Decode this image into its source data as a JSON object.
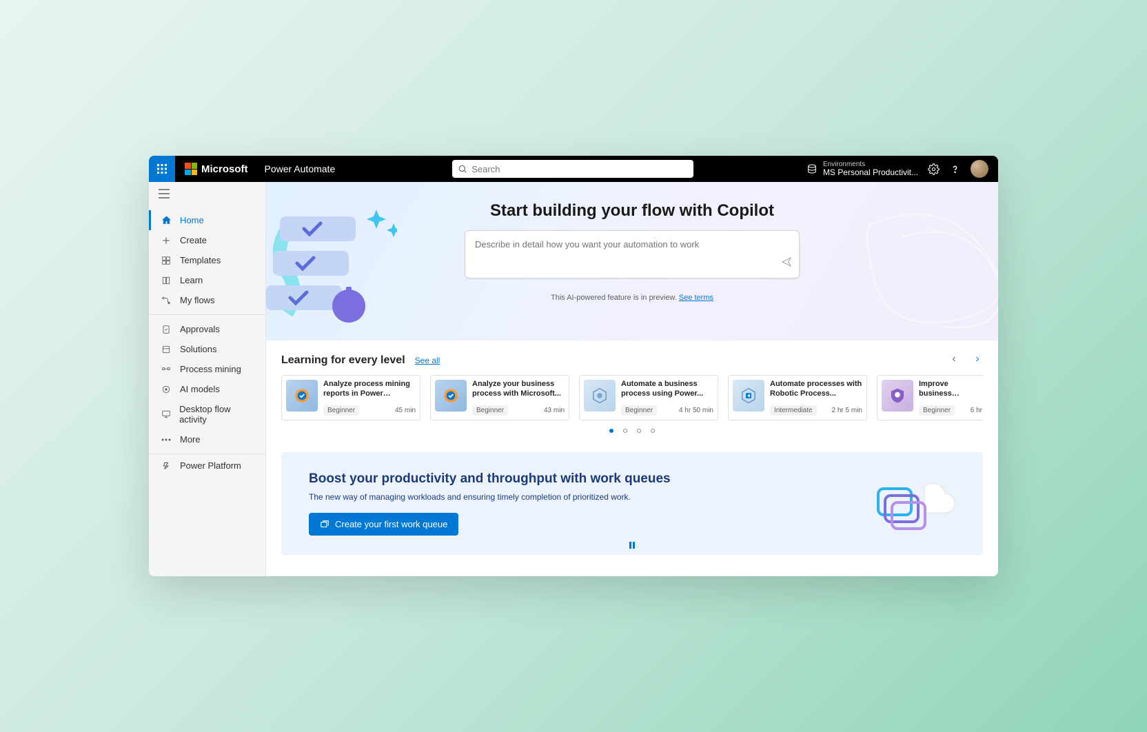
{
  "topbar": {
    "company": "Microsoft",
    "product": "Power Automate",
    "search_placeholder": "Search",
    "env_label": "Environments",
    "env_name": "MS Personal Productivit..."
  },
  "sidebar": {
    "items": [
      {
        "label": "Home"
      },
      {
        "label": "Create"
      },
      {
        "label": "Templates"
      },
      {
        "label": "Learn"
      },
      {
        "label": "My flows"
      }
    ],
    "items2": [
      {
        "label": "Approvals"
      },
      {
        "label": "Solutions"
      },
      {
        "label": "Process mining"
      },
      {
        "label": "AI models"
      },
      {
        "label": "Desktop flow activity"
      },
      {
        "label": "More"
      }
    ],
    "platform_label": "Power Platform"
  },
  "hero": {
    "title": "Start building your flow with Copilot",
    "placeholder": "Describe in detail how you want your automation to work",
    "preview_text": "This AI-powered feature is in preview. ",
    "terms_link": "See terms"
  },
  "learning": {
    "title": "Learning for every level",
    "see_all": "See all",
    "cards": [
      {
        "title": "Analyze process mining reports in Power Automate",
        "level": "Beginner",
        "duration": "45 min"
      },
      {
        "title": "Analyze your business process with Microsoft...",
        "level": "Beginner",
        "duration": "43 min"
      },
      {
        "title": "Automate a business process using Power...",
        "level": "Beginner",
        "duration": "4 hr 50 min"
      },
      {
        "title": "Automate processes with Robotic Process...",
        "level": "Intermediate",
        "duration": "2 hr 5 min"
      },
      {
        "title": "Improve business performance with AI...",
        "level": "Beginner",
        "duration": "6 hr"
      }
    ]
  },
  "promo": {
    "title": "Boost your productivity and throughput with work queues",
    "subtitle": "The new way of managing workloads and ensuring timely completion of prioritized work.",
    "button": "Create your first work queue"
  }
}
